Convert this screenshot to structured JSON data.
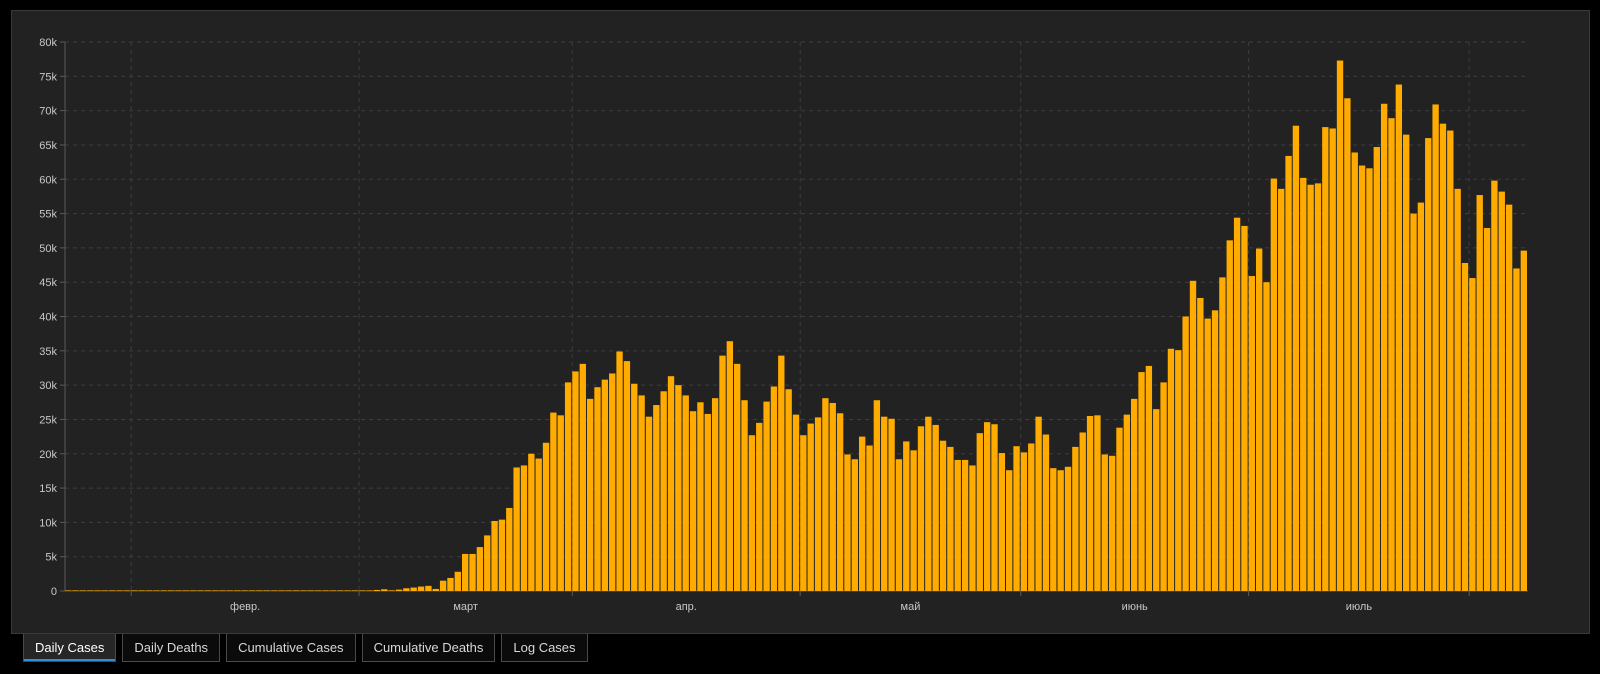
{
  "colors": {
    "bar": "#FFAB00",
    "grid": "#3d3d3d",
    "axis": "#5a5a5a",
    "text": "#c8c8c8",
    "active_tab_underline": "#2f8fd8"
  },
  "tabs": [
    {
      "label": "Daily Cases",
      "active": true
    },
    {
      "label": "Daily Deaths",
      "active": false
    },
    {
      "label": "Cumulative Cases",
      "active": false
    },
    {
      "label": "Cumulative Deaths",
      "active": false
    },
    {
      "label": "Log Cases",
      "active": false
    }
  ],
  "chart_data": {
    "type": "bar",
    "ylim": [
      0,
      80000
    ],
    "yticks": [
      "0",
      "5k",
      "10k",
      "15k",
      "20k",
      "25k",
      "30k",
      "35k",
      "40k",
      "45k",
      "50k",
      "55k",
      "60k",
      "65k",
      "70k",
      "75k",
      "80k"
    ],
    "xticks": [
      "февр.",
      "март",
      "апр.",
      "май",
      "июнь",
      "июль"
    ],
    "grid": true,
    "values": [
      0,
      0,
      0,
      0,
      0,
      0,
      0,
      0,
      0,
      0,
      0,
      0,
      0,
      0,
      0,
      0,
      0,
      0,
      0,
      0,
      0,
      0,
      0,
      0,
      0,
      0,
      0,
      0,
      0,
      0,
      0,
      0,
      0,
      0,
      0,
      0,
      0,
      0,
      0,
      0,
      0,
      0,
      150,
      250,
      100,
      200,
      400,
      500,
      650,
      750,
      300,
      1500,
      1900,
      2800,
      5400,
      5400,
      6400,
      8100,
      10200,
      10400,
      12100,
      18000,
      18300,
      20000,
      19300,
      21600,
      26000,
      25600,
      30400,
      32000,
      33100,
      28000,
      29700,
      30800,
      31700,
      34900,
      33500,
      30200,
      28500,
      25400,
      27100,
      29100,
      31300,
      30000,
      28500,
      26200,
      27500,
      25800,
      28100,
      34300,
      36400,
      33100,
      27800,
      22700,
      24500,
      27600,
      29800,
      34300,
      29400,
      25700,
      22700,
      24400,
      25300,
      28100,
      27400,
      25900,
      19900,
      19200,
      22500,
      21200,
      27800,
      25400,
      25100,
      19200,
      21800,
      20500,
      24000,
      25400,
      24200,
      21900,
      21000,
      19100,
      19100,
      18300,
      23000,
      24600,
      24300,
      20100,
      17600,
      21100,
      20200,
      21500,
      25400,
      22800,
      17900,
      17600,
      18100,
      21000,
      23100,
      25500,
      25600,
      19900,
      19700,
      23800,
      25700,
      28000,
      31900,
      32800,
      26500,
      30400,
      35300,
      35100,
      40000,
      45200,
      42700,
      39700,
      40900,
      45700,
      51100,
      54400,
      53200,
      45900,
      49900,
      45000,
      60100,
      58600,
      63400,
      67800,
      60200,
      59200,
      59400,
      67600,
      67400,
      77300,
      71800,
      63900,
      62000,
      61600,
      64700,
      71000,
      68900,
      73800,
      66500,
      55000,
      56600,
      66000,
      70900,
      68100,
      67100,
      58600,
      47800,
      45600,
      57700,
      52900,
      59800,
      58200,
      56300,
      47000,
      49600
    ]
  }
}
